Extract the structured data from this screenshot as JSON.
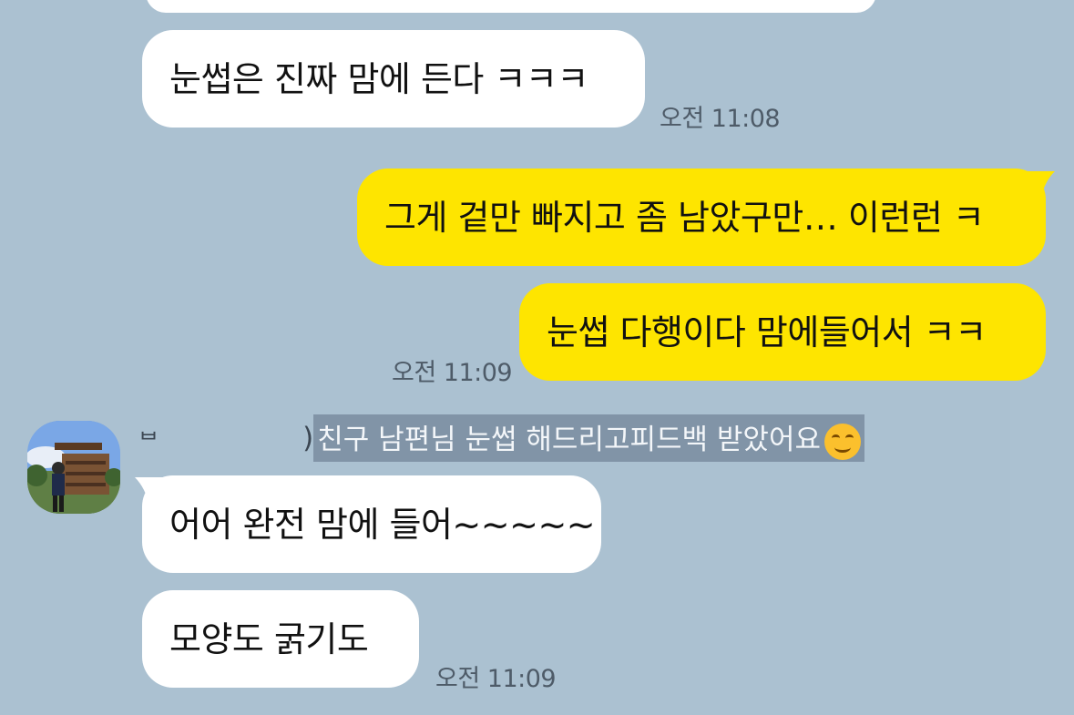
{
  "messages": {
    "top_partial": "",
    "m1": {
      "text": "눈썹은 진짜 맘에 든다 ㅋㅋㅋ",
      "time": "오전 11:08"
    },
    "m2": {
      "text": "그게 겉만 빠지고 좀 남았구만… 이런런 ㅋ"
    },
    "m3": {
      "text": "눈썹 다행이다 맘에들어서 ㅋㅋ",
      "time": "오전 11:09"
    },
    "reply": {
      "sender_visible": "ᄇ",
      "sender_suffix": ")",
      "quoted_text": "친구 남편님 눈썹 해드리고피드백 받았어요"
    },
    "m4": {
      "text": "어어 완전 맘에 들어~~~~~"
    },
    "m5": {
      "text": "모양도 굵기도",
      "time": "오전 11:09"
    }
  },
  "icons": {
    "emoji": "smiling-face-emoji",
    "avatar": "profile-photo"
  },
  "colors": {
    "background": "#abc1d1",
    "incoming_bubble": "#ffffff",
    "outgoing_bubble": "#fee500",
    "selection": "#8194a7"
  }
}
